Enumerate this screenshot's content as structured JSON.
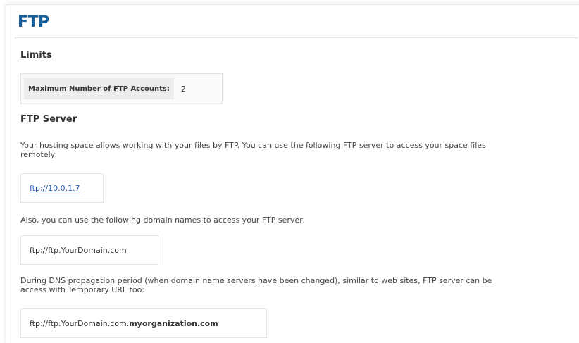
{
  "page": {
    "title": "FTP"
  },
  "limits": {
    "heading": "Limits",
    "label": "Maximum Number of FTP Accounts:",
    "value": "2"
  },
  "ftp_server": {
    "heading": "FTP Server",
    "intro_line1": "Your hosting space allows working with your files by FTP. You can use the following FTP server to access your space files",
    "intro_line2": "remotely:",
    "server_url": "ftp://10.0.1.7",
    "domain_intro": "Also, you can use the following domain names to access your FTP server:",
    "domain_url": "ftp://ftp.YourDomain.com",
    "dns_line1": "During DNS propagation period (when domain name servers have been changed), similar to web sites, FTP server can be",
    "dns_line2": "access with Temporary URL too:",
    "temp_url_prefix": "ftp://ftp.YourDomain.com.",
    "temp_url_suffix": "myorganization.com"
  },
  "colors": {
    "title": "#1a5f9a",
    "link": "#2a5db0"
  }
}
